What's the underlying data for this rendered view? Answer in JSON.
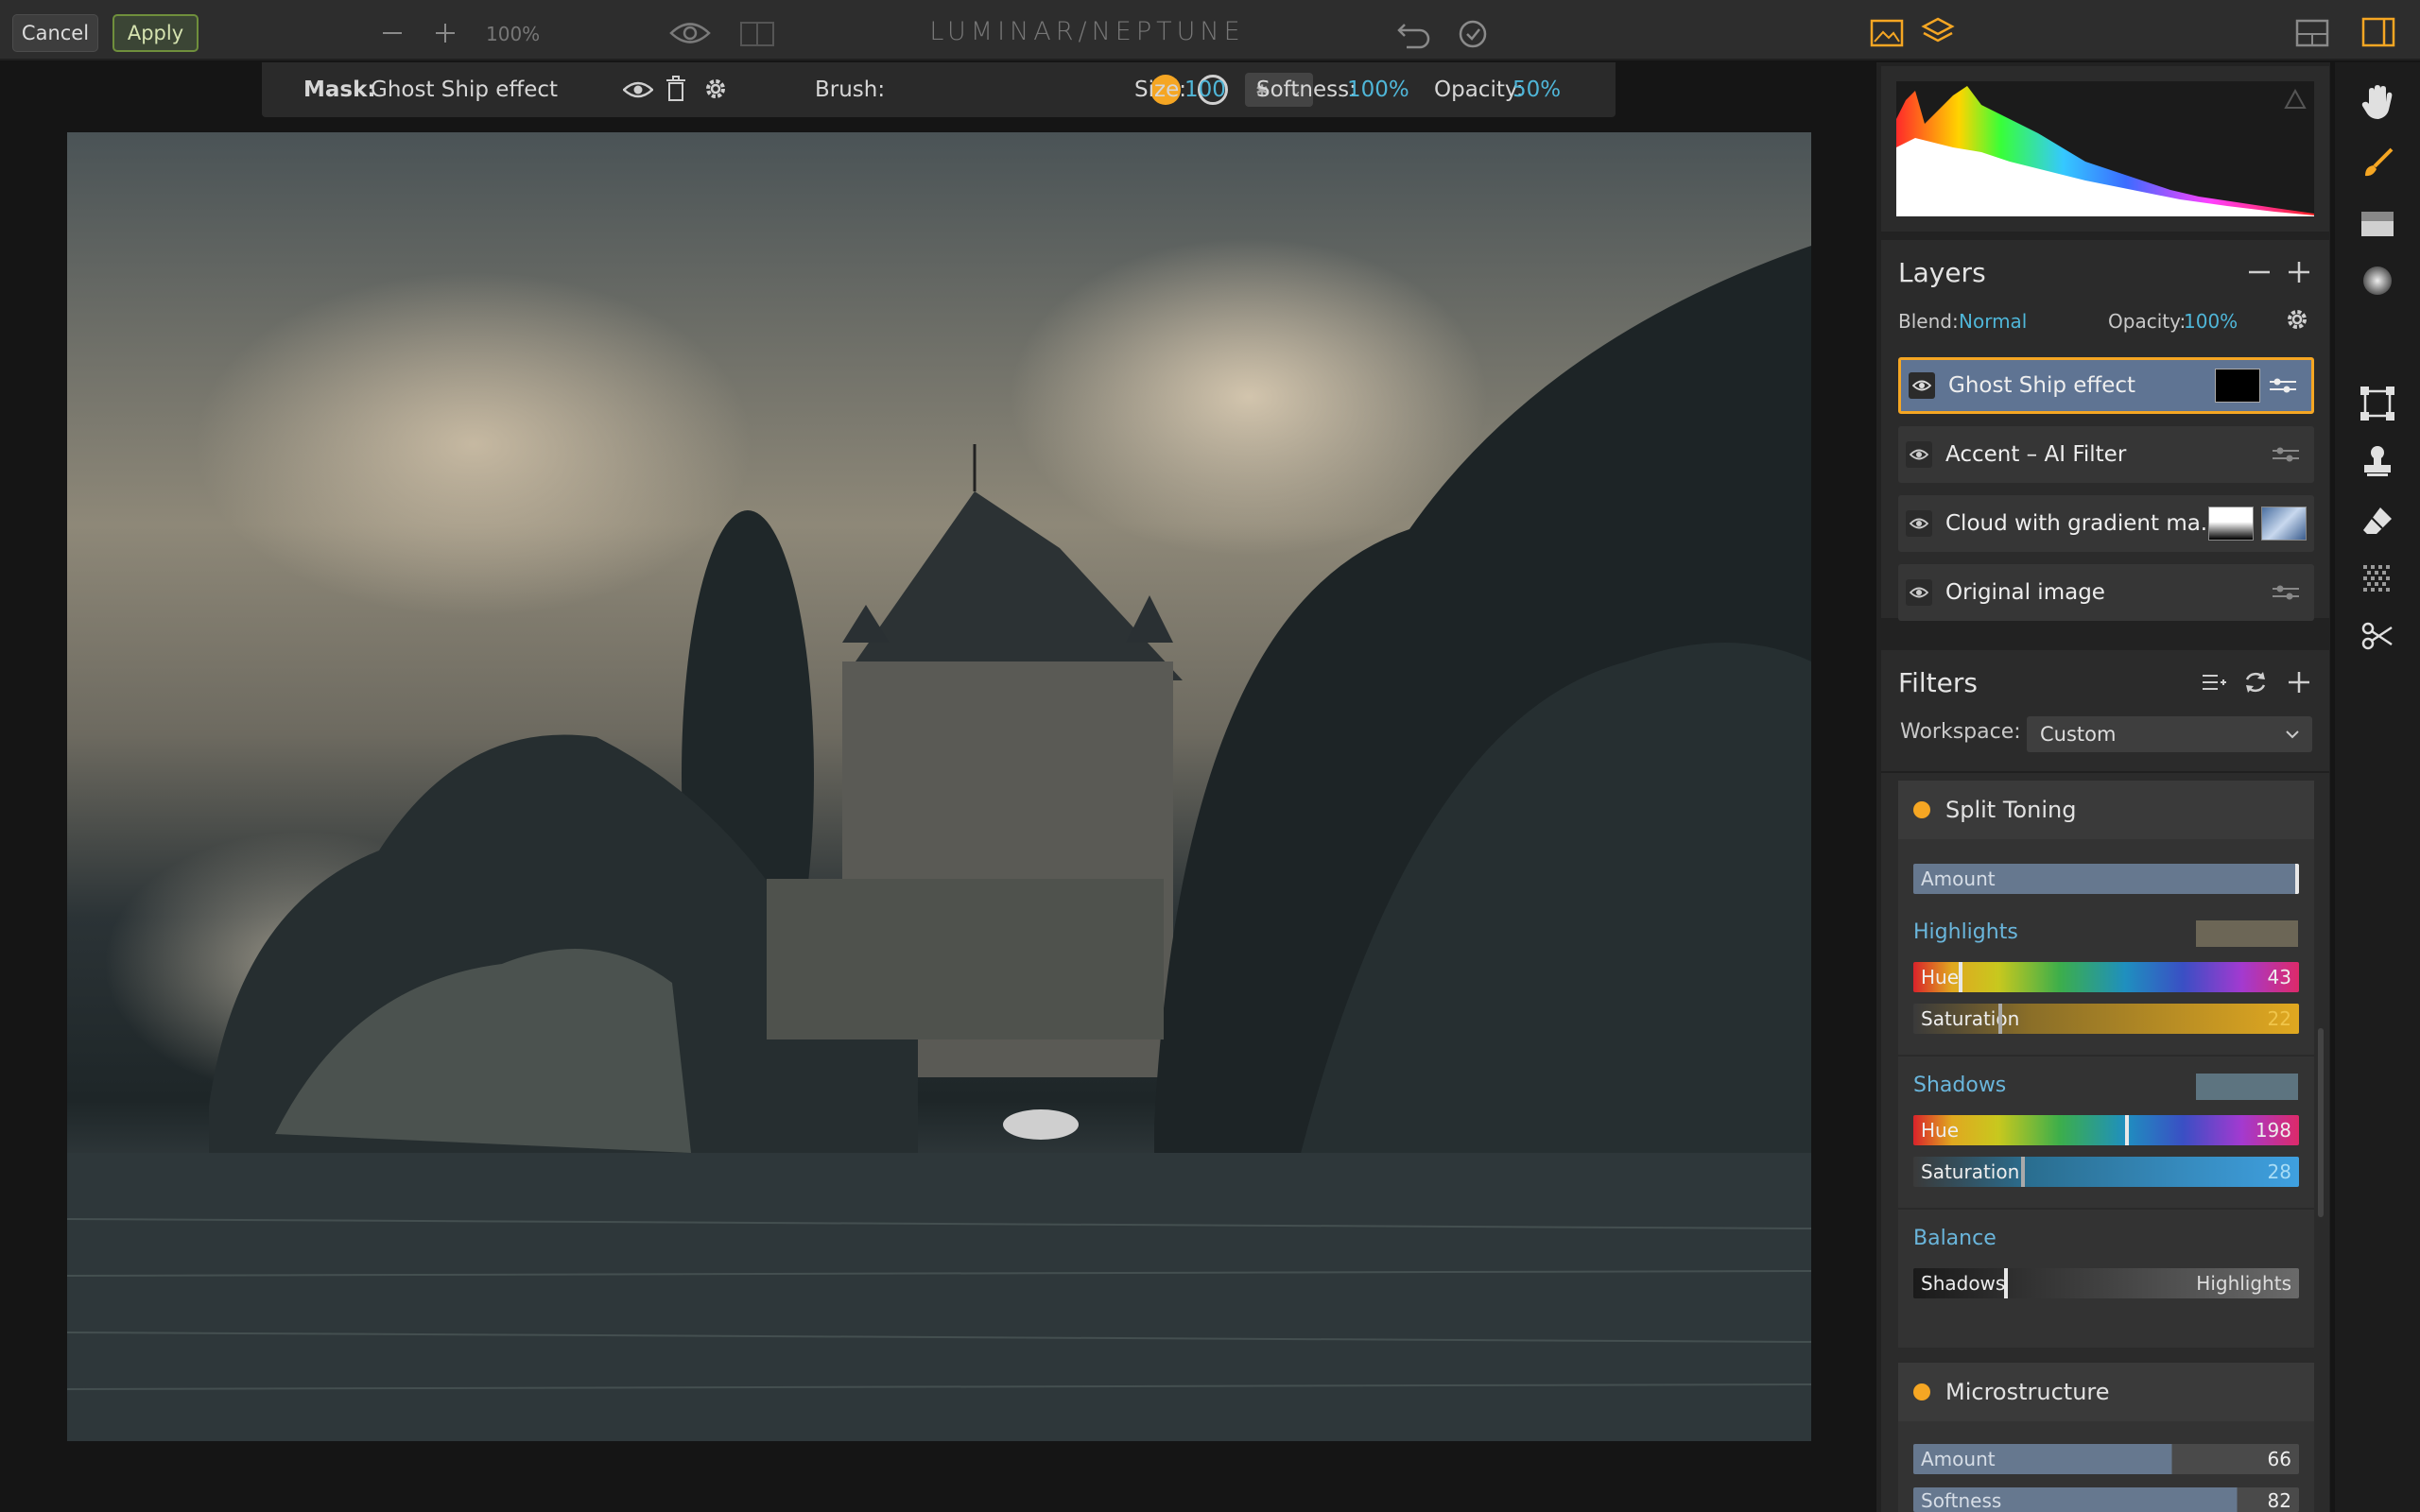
{
  "toolbar": {
    "cancel_label": "Cancel",
    "apply_label": "Apply",
    "zoom": "100%",
    "app_title": "LUMINAR/NEPTUNE"
  },
  "mask_toolbar": {
    "mask_label": "Mask:",
    "mask_name": "Ghost Ship effect",
    "brush_label": "Brush:",
    "size_label": "Size:",
    "size_value": "100",
    "softness_label": "Softness:",
    "softness_value": "100%",
    "opacity_label": "Opacity:",
    "opacity_value": "50%"
  },
  "layers": {
    "title": "Layers",
    "blend_label": "Blend:",
    "blend_value": "Normal",
    "opacity_label": "Opacity:",
    "opacity_value": "100%",
    "items": [
      {
        "name": "Ghost Ship effect",
        "selected": true
      },
      {
        "name": "Accent – AI Filter",
        "selected": false
      },
      {
        "name": "Cloud with gradient ma...",
        "selected": false
      },
      {
        "name": "Original image",
        "selected": false
      }
    ]
  },
  "filters": {
    "title": "Filters",
    "workspace_label": "Workspace:",
    "workspace_value": "Custom",
    "split_toning": {
      "title": "Split Toning",
      "amount_label": "Amount",
      "amount_value": 100,
      "highlights_label": "Highlights",
      "highlights_color": "#6c6656",
      "highlights_hue_label": "Hue",
      "highlights_hue": "43",
      "highlights_sat_label": "Saturation",
      "highlights_sat": "22",
      "shadows_label": "Shadows",
      "shadows_color": "#5d7480",
      "shadows_hue_label": "Hue",
      "shadows_hue": "198",
      "shadows_sat_label": "Saturation",
      "shadows_sat": "28",
      "balance_label": "Balance",
      "balance_left": "Shadows",
      "balance_right": "Highlights"
    },
    "microstructure": {
      "title": "Microstructure",
      "amount_label": "Amount",
      "amount_value": "66",
      "softness_label": "Softness",
      "softness_value": "82"
    }
  },
  "colors": {
    "accent": "#f5a623",
    "value_cyan": "#4fb6d8",
    "selected_layer": "#5f7493"
  }
}
